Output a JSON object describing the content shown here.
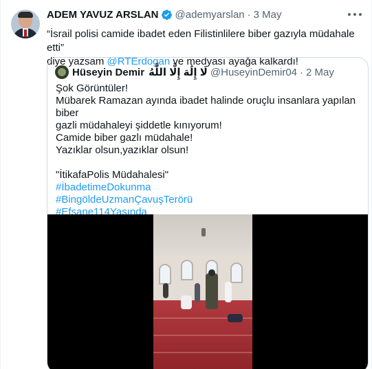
{
  "tweet": {
    "author_name": "ADEM YAVUZ ARSLAN",
    "author_handle": "@ademyarslan",
    "separator": "·",
    "date": "3 May",
    "text_line1": "“İsrail polisi camide ibadet eden Filistinlilere biber gazıyla müdahale etti”",
    "text_line2_prefix": "diye yazsam ",
    "mention": "@RTErdogan",
    "text_line2_suffix": " ve medyası ayağa kalkardı!",
    "icons": {
      "avatar": "user-photo",
      "verified": "verified-badge-icon",
      "more": "more-horizontal-icon"
    }
  },
  "quote": {
    "author_name": "Hüseyin Demir",
    "author_arabic": "لَا إِلَٰهَ إِلَّا اللَّٰهُ",
    "author_handle": "@HuseyinDemir04",
    "separator": "·",
    "date": "2 May",
    "lines": [
      "Şok Görüntüler!",
      "Mübarek Ramazan ayında ibadet halinde oruçlu insanlara yapılan biber",
      "gazli müdahaleyi şiddetle kınıyorum!",
      "Camide biber gazlı müdahale!",
      "Yazıklar olsun,yazıklar olsun!"
    ],
    "hashtags": [
      "\"İtikafaPolis Müdahalesi\"",
      "#İbadetimeDokunma",
      "#BingöldeUzmanÇavuşTerörü",
      "#Efsane114Yaşında"
    ],
    "media": {
      "type": "video",
      "description_icon": "video-thumbnail"
    }
  },
  "colors": {
    "link": "#1d9bf0",
    "secondary_text": "#536471",
    "border": "#cfd9de",
    "verified": "#1d9bf0"
  }
}
